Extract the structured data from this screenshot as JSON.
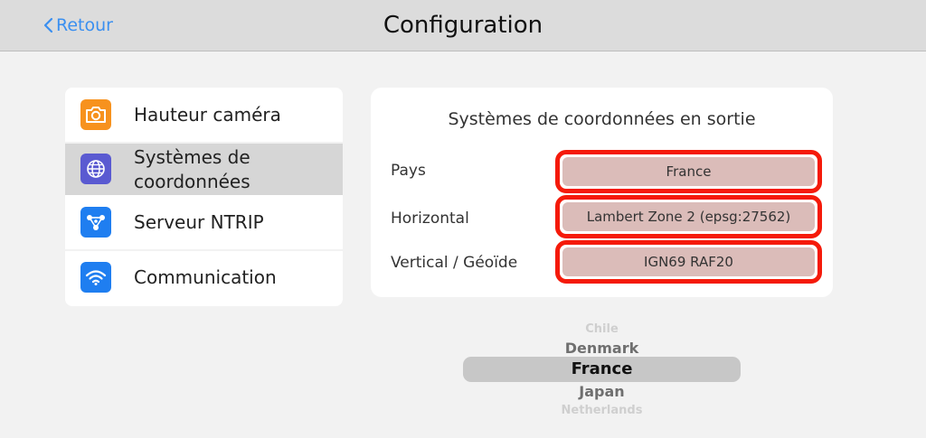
{
  "nav": {
    "back_label": "Retour",
    "title": "Configuration"
  },
  "menu": {
    "items": [
      {
        "label": "Hauteur caméra",
        "icon": "camera-icon",
        "color": "#f7921e"
      },
      {
        "label_line1": "Systèmes de",
        "label_line2": "coordonnées",
        "icon": "globe-icon",
        "color": "#5a5ad1",
        "selected": true
      },
      {
        "label": "Serveur NTRIP",
        "icon": "network-icon",
        "color": "#1f7ef0"
      },
      {
        "label": "Communication",
        "icon": "wifi-icon",
        "color": "#1f7ef0"
      }
    ]
  },
  "output_card": {
    "title": "Systèmes de coordonnées en sortie",
    "rows": [
      {
        "label": "Pays",
        "value": "France"
      },
      {
        "label": "Horizontal",
        "value": "Lambert Zone 2 (epsg:27562)"
      },
      {
        "label": "Vertical / Géoïde",
        "value": "IGN69 RAF20"
      }
    ]
  },
  "picker": {
    "options": [
      "Chile",
      "Denmark",
      "France",
      "Japan",
      "Netherlands"
    ],
    "selected": "France"
  },
  "colors": {
    "accent": "#3a8ff0",
    "highlight_border": "#f51a0a",
    "field_fill": "#dbbcb9"
  }
}
